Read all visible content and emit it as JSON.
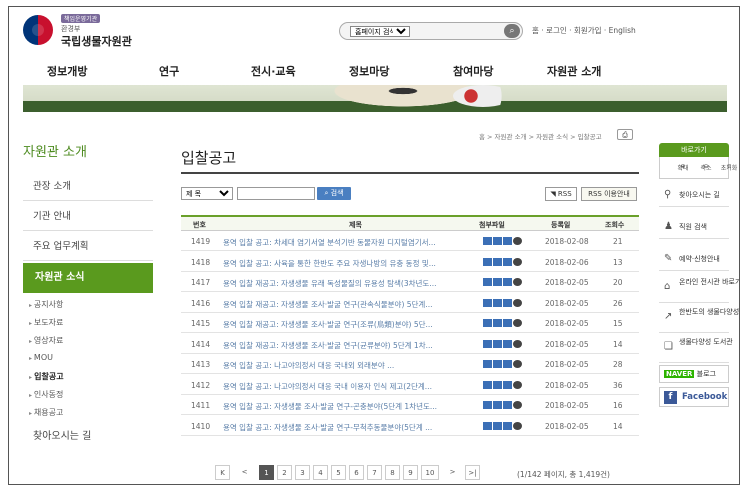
{
  "header": {
    "badge": "책임운영기관",
    "ministry": "환경부",
    "org_name": "국립생물자원관",
    "search_select": "홈페이지 검색",
    "search_icon": "magnifier-icon",
    "utility": "홈 · 로그인 · 회원가입 · English"
  },
  "gnb": [
    "정보개방",
    "연구",
    "전시·교육",
    "정보마당",
    "참여마당",
    "자원관 소개"
  ],
  "lnb": {
    "title": "자원관 소개",
    "items": [
      "관장 소개",
      "기관 안내",
      "주요 업무계획"
    ],
    "active": "자원관 소식",
    "sub": [
      "공지사항",
      "보도자료",
      "영상자료",
      "MOU",
      "입찰공고",
      "인사동정",
      "채용공고"
    ],
    "sub_active_index": 4,
    "last": "찾아오시는 길"
  },
  "breadcrumb": "홈 > 자원관 소개 > 자원관 소식 > 입찰공고",
  "page_title": "입찰공고",
  "searchbar": {
    "select": "제 목",
    "button": "검색"
  },
  "rss": {
    "button": "RSS",
    "guide": "RSS 이용안내"
  },
  "table": {
    "headers": [
      "번호",
      "제목",
      "첨부파일",
      "등록일",
      "조회수"
    ],
    "rows": [
      {
        "no": "1419",
        "title": "용역 입찰 공고: 차세대 염기서열 분석기반 동물자원 디지털염기서...",
        "date": "2018-02-08",
        "views": "21"
      },
      {
        "no": "1418",
        "title": "용역 입찰 공고: 사육을 통한 한반도 주요 자생나방의 유충 동정 및...",
        "date": "2018-02-06",
        "views": "13"
      },
      {
        "no": "1417",
        "title": "용역 입찰 재공고: 자생생물 유래 독성물질의 유용성 탐색(3차년도...",
        "date": "2018-02-05",
        "views": "20"
      },
      {
        "no": "1416",
        "title": "용역 입찰 재공고: 자생생물 조사·발굴 연구(관속식물분야) 5단계...",
        "date": "2018-02-05",
        "views": "26"
      },
      {
        "no": "1415",
        "title": "용역 입찰 재공고: 자생생물 조사·발굴 연구(조류(鳥類)분야) 5단...",
        "date": "2018-02-05",
        "views": "15"
      },
      {
        "no": "1414",
        "title": "용역 입찰 재공고: 자생생물 조사·발굴 연구(균류분야) 5단계 1차...",
        "date": "2018-02-05",
        "views": "14"
      },
      {
        "no": "1413",
        "title": "용역 입찰 공고: 나고야의정서 대응 국내외 외래분야 ...",
        "date": "2018-02-05",
        "views": "28"
      },
      {
        "no": "1412",
        "title": "용역 입찰 공고: 나고야의정서 대응 국내 이용자 인식 제고(2단계...",
        "date": "2018-02-05",
        "views": "36"
      },
      {
        "no": "1411",
        "title": "용역 입찰 공고: 자생생물 조사·발굴 연구-곤충분야(5단계 1차년도...",
        "date": "2018-02-05",
        "views": "16"
      },
      {
        "no": "1410",
        "title": "용역 입찰 공고: 자생생물 조사·발굴 연구-무척추동물분야(5단계 ...",
        "date": "2018-02-05",
        "views": "14"
      }
    ]
  },
  "pager": {
    "first": "K",
    "prev": "<",
    "next": ">",
    "last": ">|",
    "pages": [
      "1",
      "2",
      "3",
      "4",
      "5",
      "6",
      "7",
      "8",
      "9",
      "10"
    ],
    "current": "1",
    "info": "(1/142 페이지, 총 1,419건)"
  },
  "quick": {
    "head": "바로가기",
    "zoom": [
      "확대",
      "축소",
      "초기화"
    ],
    "items": [
      {
        "label": "찾아오시는 길",
        "icon": "location-icon"
      },
      {
        "label": "직원 검색",
        "icon": "person-icon"
      },
      {
        "label": "예약·신청안내",
        "icon": "form-icon"
      },
      {
        "label": "온라인 전시관 바로가기",
        "icon": "building-icon"
      },
      {
        "label": "한반도의 생물다양성",
        "icon": "link-out-icon"
      },
      {
        "label": "생물다양성 도서관",
        "icon": "book-icon"
      }
    ],
    "naver": "NAVER",
    "naver_suffix": "블로그",
    "facebook": "Facebook"
  },
  "colors": {
    "accent": "#5a9a1e",
    "link": "#5a7ea8"
  }
}
